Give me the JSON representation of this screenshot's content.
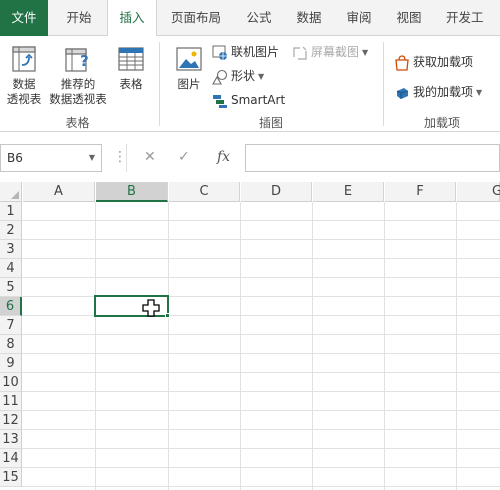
{
  "tabs": {
    "file": "文件",
    "home": "开始",
    "insert": "插入",
    "page_layout": "页面布局",
    "formulas": "公式",
    "data": "数据",
    "review": "审阅",
    "view": "视图",
    "developer": "开发工"
  },
  "ribbon": {
    "tables_group": {
      "title": "表格",
      "pivot_line1": "数据",
      "pivot_line2": "透视表",
      "recommended_line1": "推荐的",
      "recommended_line2": "数据透视表",
      "table": "表格"
    },
    "illustrations_group": {
      "title": "插图",
      "pictures": "图片",
      "online_pictures": "联机图片",
      "shapes": "形状",
      "smartart": "SmartArt",
      "screenshot": "屏幕截图"
    },
    "addins_group": {
      "title": "加载项",
      "get_addins": "获取加载项",
      "my_addins": "我的加载项"
    }
  },
  "formula_bar": {
    "name_box": "B6",
    "dots": "⋮",
    "cancel": "✕",
    "enter": "✓",
    "fx": "fx",
    "value": ""
  },
  "grid": {
    "columns": [
      "A",
      "B",
      "C",
      "D",
      "E",
      "F",
      "G"
    ],
    "rows": [
      "1",
      "2",
      "3",
      "4",
      "5",
      "6",
      "7",
      "8",
      "9",
      "10",
      "11",
      "12",
      "13",
      "14",
      "15"
    ],
    "selected_column": "B",
    "selected_row": "6"
  },
  "colors": {
    "accent": "#217346",
    "ribbon_bg": "#f3f3f3",
    "header_selected": "#d2d2d2"
  },
  "icons": {
    "pivot": "pivot-table-icon",
    "recommended": "recommended-pivot-icon",
    "table": "table-icon",
    "pictures": "picture-icon",
    "online_pictures": "online-picture-icon",
    "shapes": "shapes-icon",
    "smartart": "smartart-icon",
    "screenshot": "screenshot-icon",
    "store": "store-icon",
    "my_addins": "addins-icon",
    "cursor": "cell-select-cursor-icon"
  }
}
